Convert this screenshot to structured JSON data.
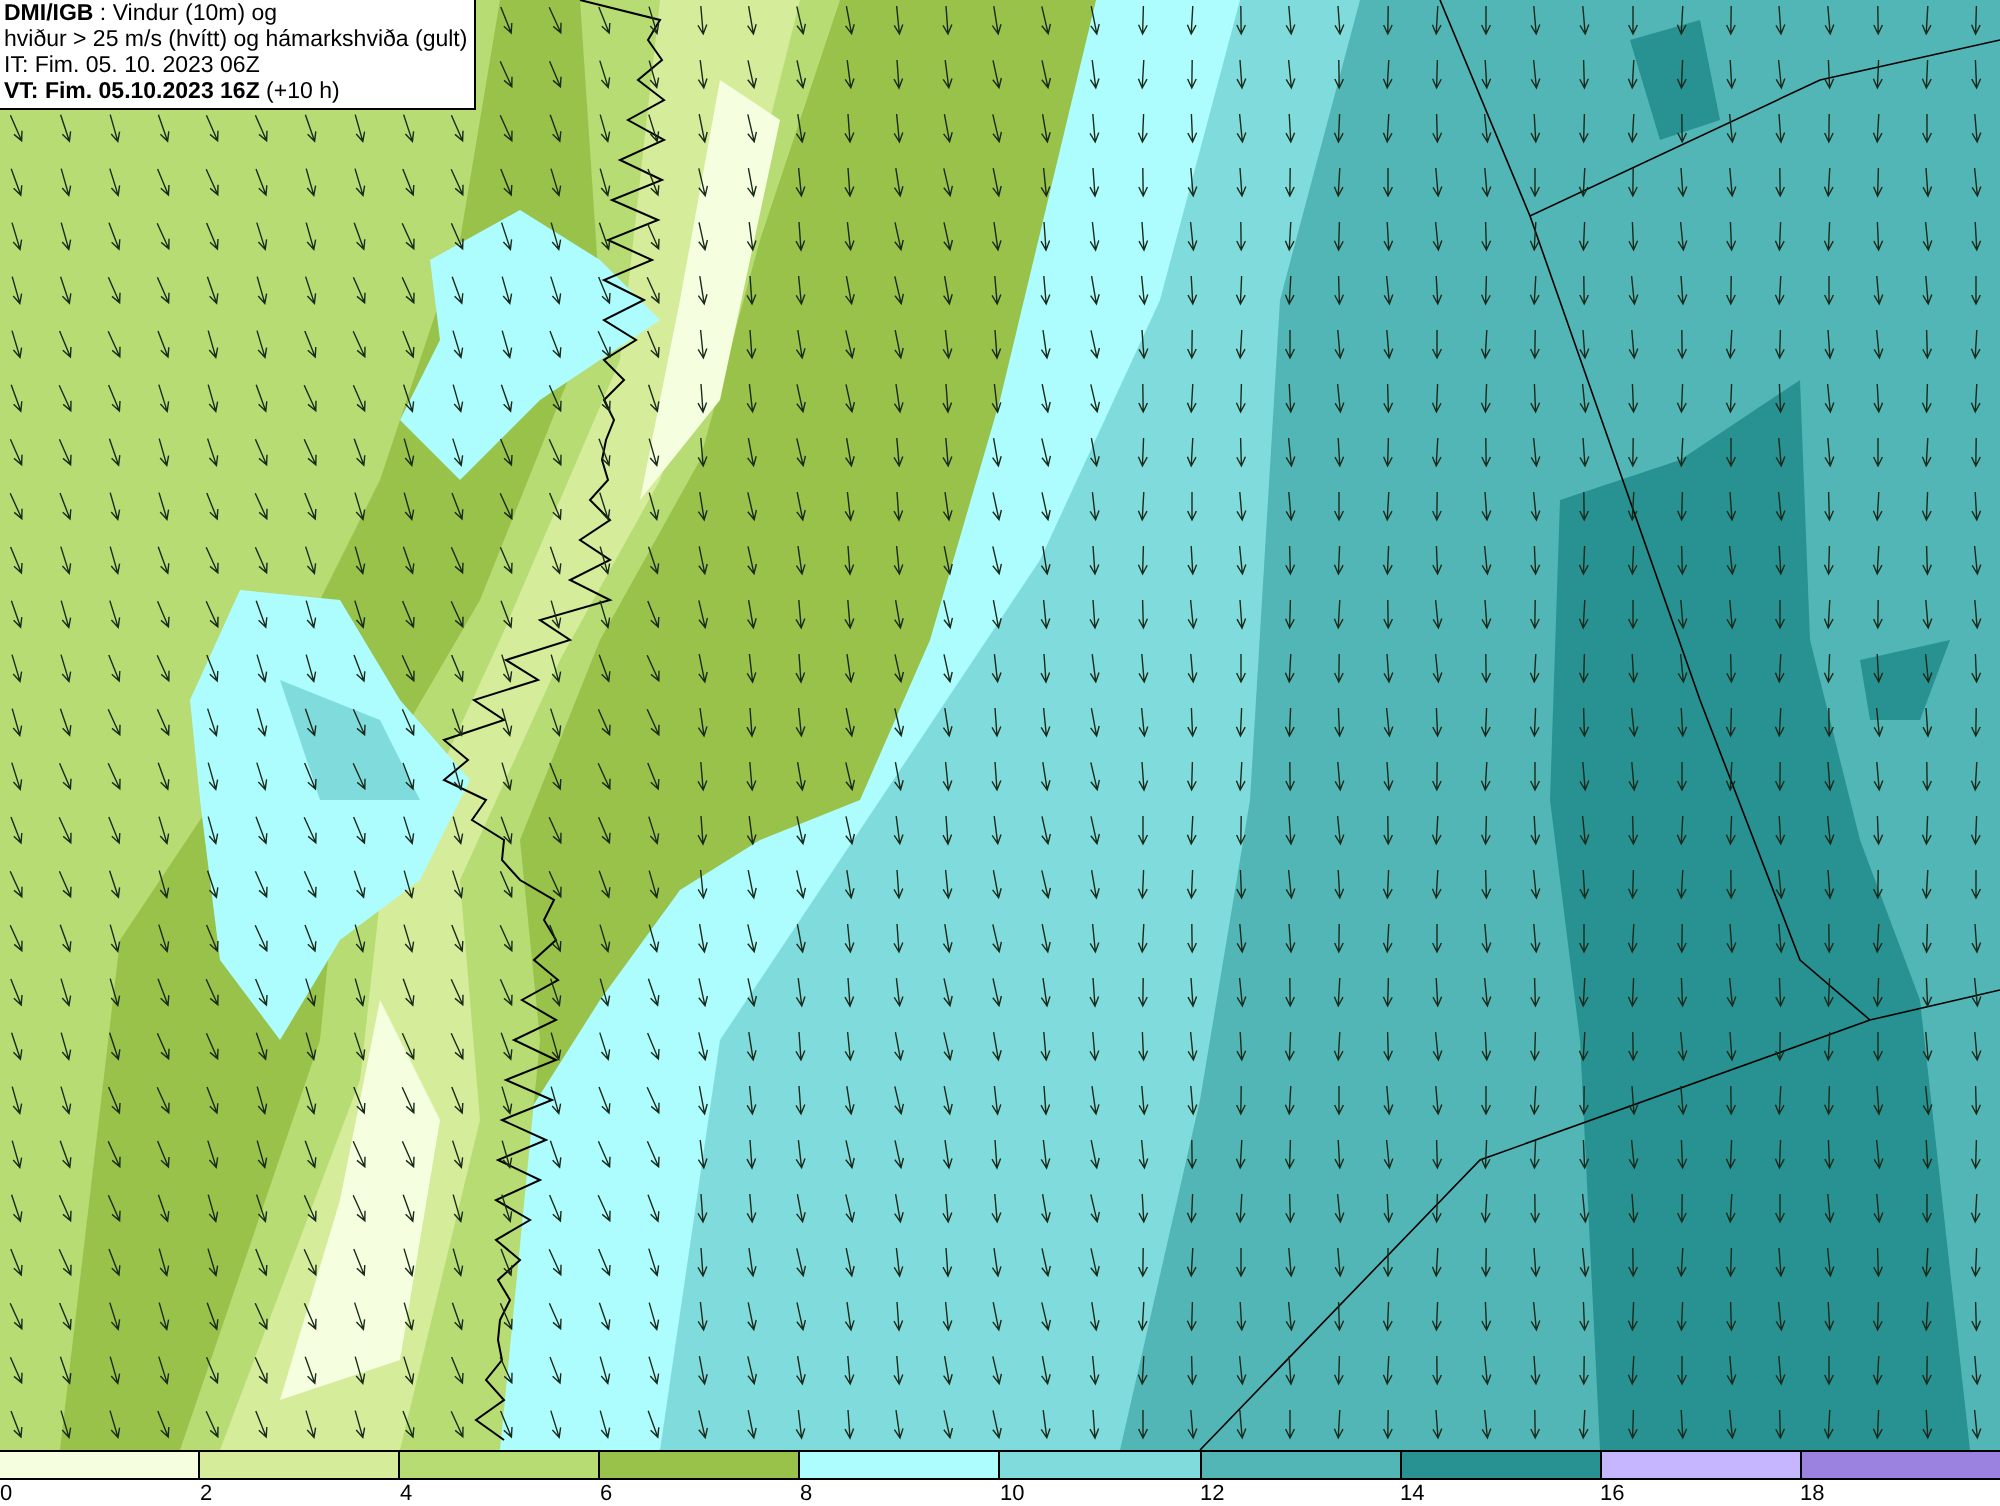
{
  "legend": {
    "lines": [
      "**DMI/IGB** : Vindur (10m) og",
      "hviður > 25 m/s (hvítt) og hámarkshviða (gult)",
      "IT: Fim. 05. 10. 2023 06Z",
      "**VT: Fim. 05.10.2023 16Z** (+10 h)"
    ]
  },
  "colorbar": {
    "bins": [
      {
        "color": "#f5ffe0"
      },
      {
        "color": "#d5ec9a"
      },
      {
        "color": "#b6dc73"
      },
      {
        "color": "#98c24a"
      },
      {
        "color": "#adfdff"
      },
      {
        "color": "#80dcdc"
      },
      {
        "color": "#52b6b6"
      },
      {
        "color": "#279291"
      },
      {
        "color": "#c5b6ff"
      },
      {
        "color": "#9b82e0"
      }
    ],
    "ticks": [
      "0",
      "2",
      "4",
      "6",
      "8",
      "10",
      "12",
      "14",
      "16",
      "18"
    ]
  }
}
